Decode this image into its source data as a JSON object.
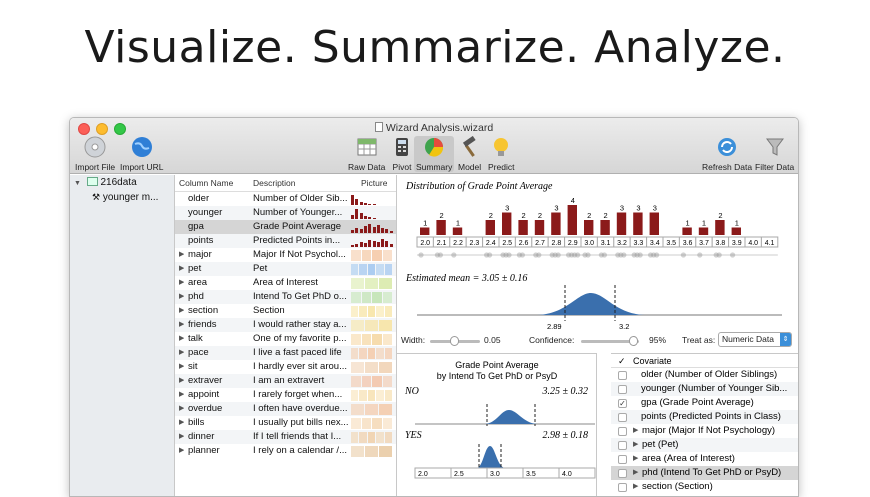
{
  "headline": "Visualize. Summarize. Analyze.",
  "window": {
    "title": "Wizard Analysis.wizard"
  },
  "toolbar": {
    "import_file": "Import File",
    "import_url": "Import URL",
    "raw_data": "Raw Data",
    "pivot": "Pivot",
    "summary": "Summary",
    "model": "Model",
    "predict": "Predict",
    "refresh_data": "Refresh Data",
    "filter_data": "Filter Data"
  },
  "sidebar": {
    "dataset": "216data",
    "item": "younger m..."
  },
  "columns_table": {
    "headers": {
      "name": "Column Name",
      "description": "Description",
      "picture": "Picture"
    },
    "rows": [
      {
        "name": "older",
        "description": "Number of Older Sib...",
        "expand": false
      },
      {
        "name": "younger",
        "description": "Number of Younger...",
        "expand": false
      },
      {
        "name": "gpa",
        "description": "Grade Point Average",
        "expand": false
      },
      {
        "name": "points",
        "description": "Predicted Points in...",
        "expand": false
      },
      {
        "name": "major",
        "description": "Major If Not Psychol...",
        "expand": true
      },
      {
        "name": "pet",
        "description": "Pet",
        "expand": true
      },
      {
        "name": "area",
        "description": "Area of Interest",
        "expand": true
      },
      {
        "name": "phd",
        "description": "Intend To Get PhD o...",
        "expand": true
      },
      {
        "name": "section",
        "description": "Section",
        "expand": true
      },
      {
        "name": "friends",
        "description": "I would rather stay a...",
        "expand": true
      },
      {
        "name": "talk",
        "description": "One of my favorite p...",
        "expand": true
      },
      {
        "name": "pace",
        "description": "I live a fast paced life",
        "expand": true
      },
      {
        "name": "sit",
        "description": "I hardly ever sit arou...",
        "expand": true
      },
      {
        "name": "extraver",
        "description": "I am an extravert",
        "expand": true
      },
      {
        "name": "appoint",
        "description": "I rarely forget when...",
        "expand": true
      },
      {
        "name": "overdue",
        "description": "I often have overdue...",
        "expand": true
      },
      {
        "name": "bills",
        "description": "I usually put bills nex...",
        "expand": true
      },
      {
        "name": "dinner",
        "description": "If I tell friends that I...",
        "expand": true
      },
      {
        "name": "planner",
        "description": "I rely on a calendar /...",
        "expand": true
      }
    ]
  },
  "distribution": {
    "title": "Distribution of Grade Point Average",
    "estimate": "Estimated mean = 3.05 ± 0.16",
    "ci_low": "2.89",
    "ci_high": "3.2"
  },
  "chart_data": [
    {
      "type": "bar",
      "title": "Distribution of Grade Point Average",
      "categories": [
        "2.0",
        "2.1",
        "2.2",
        "2.3",
        "2.4",
        "2.5",
        "2.6",
        "2.7",
        "2.8",
        "2.9",
        "3.0",
        "3.1",
        "3.2",
        "3.3",
        "3.4",
        "3.5",
        "3.6",
        "3.7",
        "3.8",
        "3.9",
        "4.0",
        "4.1"
      ],
      "values": [
        1,
        2,
        1,
        0,
        2,
        3,
        2,
        2,
        3,
        4,
        2,
        2,
        3,
        3,
        3,
        0,
        1,
        1,
        2,
        1,
        0,
        0
      ],
      "bar_colors": "#8b1a1a"
    }
  ],
  "controls": {
    "width_label": "Width:",
    "width_value": "0.05",
    "confidence_label": "Confidence:",
    "confidence_value": "95%",
    "treat_label": "Treat as:",
    "treat_value": "Numeric Data"
  },
  "split_plot": {
    "title_line1": "Grade Point Average",
    "title_line2": "by Intend To Get PhD or PsyD",
    "groups": [
      {
        "label": "NO",
        "estimate": "3.25 ± 0.32"
      },
      {
        "label": "YES",
        "estimate": "2.98 ± 0.18"
      }
    ],
    "axis_ticks": [
      "2.0",
      "2.5",
      "3.0",
      "3.5",
      "4.0"
    ]
  },
  "covariates": {
    "header": "Covariate",
    "items": [
      {
        "label": "older (Number of Older Siblings)",
        "checked": false,
        "expand": false
      },
      {
        "label": "younger (Number of Younger Sib...",
        "checked": false,
        "expand": false
      },
      {
        "label": "gpa (Grade Point Average)",
        "checked": true,
        "expand": false
      },
      {
        "label": "points (Predicted Points in Class)",
        "checked": false,
        "expand": false
      },
      {
        "label": "major (Major If Not Psychology)",
        "checked": false,
        "expand": true
      },
      {
        "label": "pet (Pet)",
        "checked": false,
        "expand": true
      },
      {
        "label": "area (Area of Interest)",
        "checked": false,
        "expand": true
      },
      {
        "label": "phd (Intend To Get PhD or PsyD)",
        "checked": false,
        "expand": true
      },
      {
        "label": "section (Section)",
        "checked": false,
        "expand": true
      }
    ]
  },
  "colors": {
    "bar": "#8b1a1a",
    "density": "#3a6fad",
    "selection": "#d5d5d5"
  }
}
